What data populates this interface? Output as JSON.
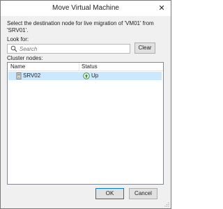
{
  "window": {
    "title": "Move Virtual Machine"
  },
  "description": "Select the destination node for live migration of 'VM01' from 'SRV01'.",
  "look_for": {
    "label": "Look for:",
    "placeholder": "Search",
    "value": "",
    "clear_label": "Clear"
  },
  "cluster_nodes": {
    "label": "Cluster nodes:",
    "columns": [
      "Name",
      "Status"
    ],
    "rows": [
      {
        "name": "SRV02",
        "status": "Up",
        "selected": true
      }
    ]
  },
  "buttons": {
    "ok": "OK",
    "cancel": "Cancel"
  },
  "icons": {
    "close": "close-icon",
    "search": "search-icon",
    "server": "server-icon",
    "status_up": "status-up-icon"
  },
  "colors": {
    "selection": "#cce8ff",
    "status_up": "#3a8a3a"
  }
}
